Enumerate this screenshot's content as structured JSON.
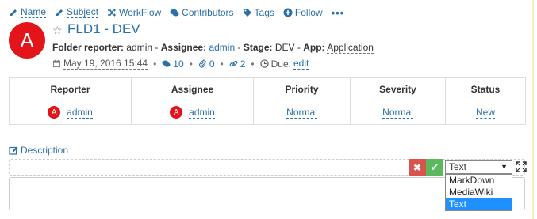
{
  "toolbar": {
    "name": "Name",
    "subject": "Subject",
    "workflow": "WorkFlow",
    "contributors": "Contributors",
    "tags": "Tags",
    "follow": "Follow",
    "more": "•••"
  },
  "header": {
    "avatar_letter": "A",
    "star": "☆",
    "title": "FLD1 - DEV"
  },
  "meta": {
    "reporter_label": "Folder reporter:",
    "reporter": "admin",
    "assignee_label": "Assignee:",
    "assignee": "admin",
    "stage_label": "Stage:",
    "stage": "DEV",
    "app_label": "App:",
    "app": "Application",
    "sep": " - "
  },
  "stats": {
    "date": "May 19, 2016 15:44",
    "comments": "10",
    "attachments": "0",
    "links": "2",
    "due_label": "Due:",
    "due_edit": "edit",
    "sep": "•"
  },
  "table": {
    "headers": [
      "Reporter",
      "Assignee",
      "Priority",
      "Severity",
      "Status"
    ],
    "row": {
      "reporter_avatar": "A",
      "reporter": "admin",
      "assignee_avatar": "A",
      "assignee": "admin",
      "priority": "Normal",
      "severity": "Normal",
      "status": "New"
    }
  },
  "description": {
    "label": "Description",
    "format_selected": "Text",
    "format_options": [
      "MarkDown",
      "MediaWiki",
      "Text"
    ]
  },
  "colors": {
    "accent": "#2a6fa8",
    "avatar": "#e3151a",
    "cancel": "#d9534f",
    "confirm": "#5cb85c",
    "selected_option": "#1e90ff"
  }
}
